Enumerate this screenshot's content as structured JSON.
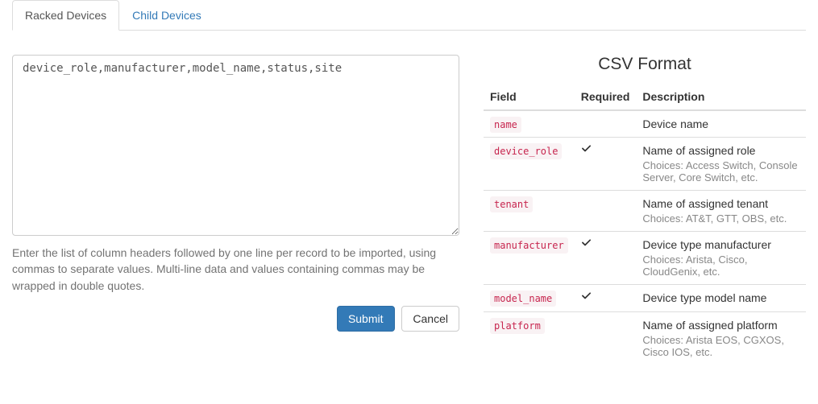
{
  "tabs": [
    {
      "label": "Racked Devices",
      "active": true
    },
    {
      "label": "Child Devices",
      "active": false
    }
  ],
  "form": {
    "textarea_value": "device_role,manufacturer,model_name,status,site",
    "help_text": "Enter the list of column headers followed by one line per record to be imported, using commas to separate values. Multi-line data and values containing commas may be wrapped in double quotes.",
    "submit_label": "Submit",
    "cancel_label": "Cancel"
  },
  "csv_table": {
    "title": "CSV Format",
    "headers": {
      "field": "Field",
      "required": "Required",
      "description": "Description"
    },
    "rows": [
      {
        "field": "name",
        "required": false,
        "description": "Device name",
        "choices": ""
      },
      {
        "field": "device_role",
        "required": true,
        "description": "Name of assigned role",
        "choices": "Choices: Access Switch, Console Server, Core Switch, etc."
      },
      {
        "field": "tenant",
        "required": false,
        "description": "Name of assigned tenant",
        "choices": "Choices: AT&T, GTT, OBS, etc."
      },
      {
        "field": "manufacturer",
        "required": true,
        "description": "Device type manufacturer",
        "choices": "Choices: Arista, Cisco, CloudGenix, etc."
      },
      {
        "field": "model_name",
        "required": true,
        "description": "Device type model name",
        "choices": ""
      },
      {
        "field": "platform",
        "required": false,
        "description": "Name of assigned platform",
        "choices": "Choices: Arista EOS, CGXOS, Cisco IOS, etc."
      }
    ]
  }
}
